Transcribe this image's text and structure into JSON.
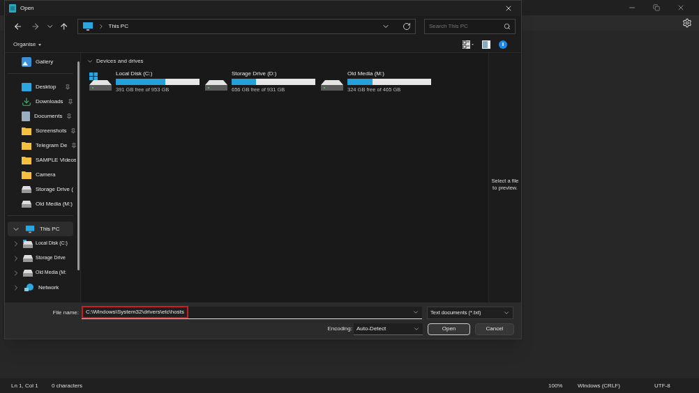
{
  "dialog": {
    "title": "Open",
    "address": {
      "path": "This PC"
    },
    "search": {
      "placeholder": "Search This PC"
    },
    "toolbar": {
      "organise": "Organise"
    },
    "sidebar": {
      "groups": [
        [
          {
            "label": "Gallery",
            "kind": "gallery",
            "pinned": false,
            "selected": false
          }
        ],
        [
          {
            "label": "Desktop",
            "kind": "desktop",
            "pinned": true,
            "selected": false
          },
          {
            "label": "Downloads",
            "kind": "download",
            "pinned": true,
            "selected": false
          },
          {
            "label": "Documents",
            "kind": "document",
            "pinned": true,
            "selected": false
          },
          {
            "label": "Screenshots",
            "kind": "folder",
            "pinned": true,
            "selected": false
          },
          {
            "label": "Telegram De",
            "kind": "folder",
            "pinned": true,
            "selected": false
          },
          {
            "label": "SAMPLE Videos",
            "kind": "folder",
            "pinned": false,
            "selected": false
          },
          {
            "label": "Camera",
            "kind": "folder",
            "pinned": false,
            "selected": false
          },
          {
            "label": "Storage Drive (",
            "kind": "drive",
            "pinned": false,
            "selected": false
          },
          {
            "label": "Old Media (M:)",
            "kind": "drive",
            "pinned": false,
            "selected": false
          }
        ],
        [
          {
            "label": "This PC",
            "kind": "pc",
            "selected": true,
            "expanded": true,
            "children": [
              {
                "label": "Local Disk (C:)",
                "kind": "system-drive",
                "selected": false,
                "expanded": false
              },
              {
                "label": "Storage Drive",
                "kind": "drive",
                "selected": false,
                "expanded": false
              },
              {
                "label": "Old Media (M:",
                "kind": "drive",
                "selected": false,
                "expanded": false
              }
            ]
          },
          {
            "label": "Network",
            "kind": "network",
            "selected": false,
            "expanded": false
          }
        ]
      ]
    },
    "section": {
      "title": "Devices and drives",
      "expanded": true
    },
    "drives": [
      {
        "name": "Local Disk (C:)",
        "system": true,
        "level": 0.59,
        "free": "391 GB free of 953 GB"
      },
      {
        "name": "Storage Drive (D:)",
        "system": false,
        "level": 0.295,
        "free": "656 GB free of 931 GB"
      },
      {
        "name": "Old Media (M:)",
        "system": false,
        "level": 0.3,
        "free": "324 GB free of 465 GB"
      }
    ],
    "preview": "Select a file to preview.",
    "file_name": {
      "label": "File name:",
      "value": "C:\\Windows\\System32\\drivers\\etc\\hosts",
      "highlighted": true
    },
    "file_type": {
      "value": "Text documents (*.txt)"
    },
    "encoding": {
      "label": "Encoding:",
      "value": "Auto-Detect"
    },
    "buttons": [
      {
        "label": "Open",
        "default": true
      },
      {
        "label": "Cancel",
        "default": false
      }
    ]
  },
  "status_bar": [
    "Ln 1, Col 1",
    "0 characters",
    "100%",
    "Windows (CRLF)",
    "UTF-8"
  ]
}
